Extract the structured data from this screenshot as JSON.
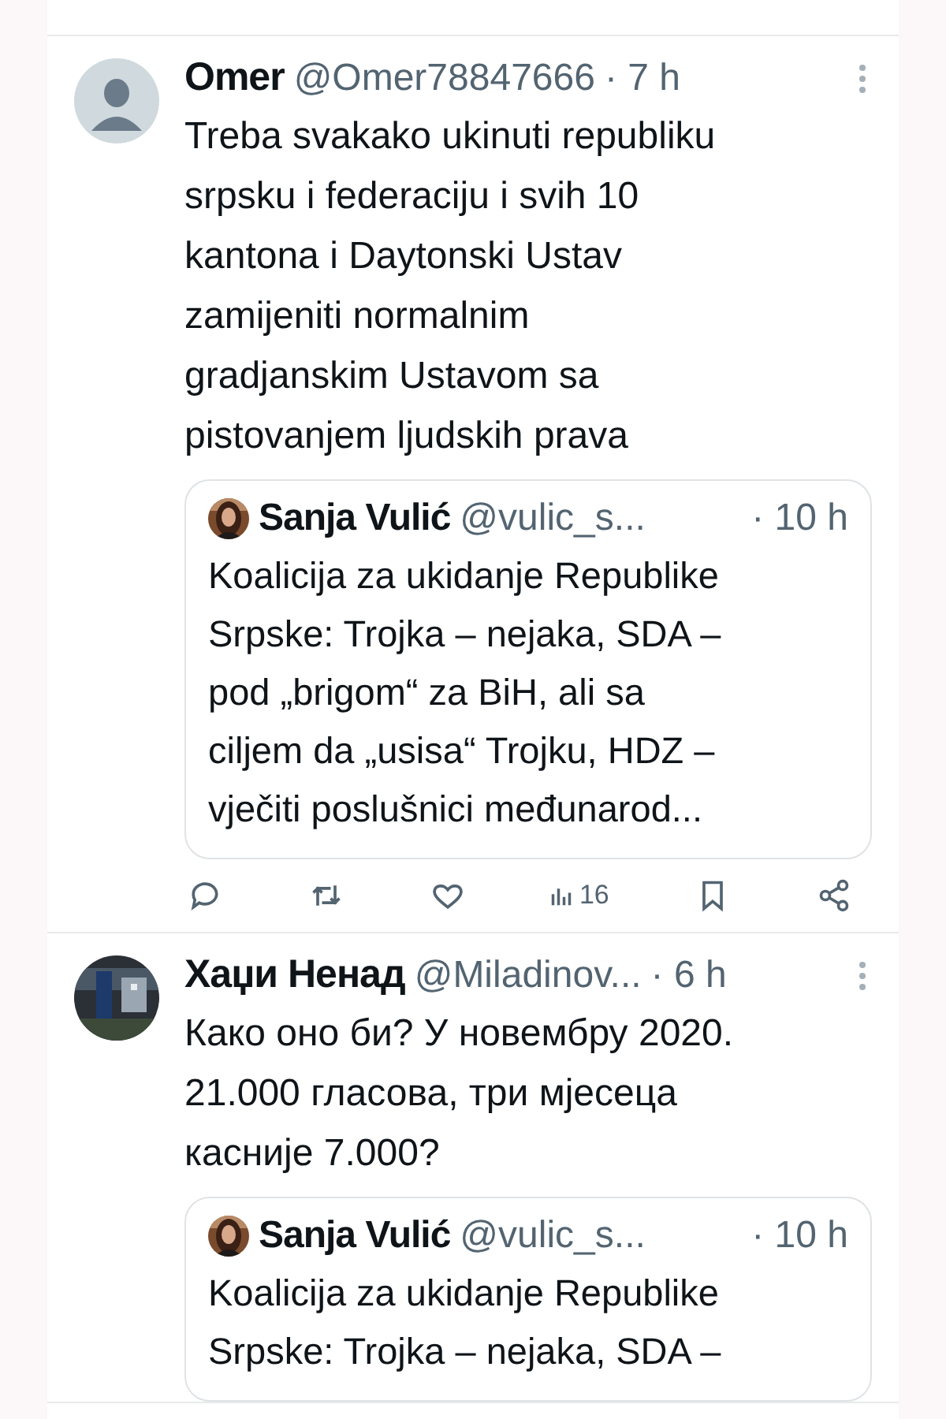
{
  "tweets": [
    {
      "avatar": {
        "kind": "default"
      },
      "author": "Omer",
      "handle": "@Omer78847666",
      "time": "· 7 h",
      "text": "Treba svakako ukinuti republiku\nsrpsku i federaciju i svih 10\nkantona i Daytonski Ustav\nzamijeniti normalnim\ngradjanskim Ustavom sa\npistovanjem ljudskih prava",
      "quote": {
        "author": "Sanja Vulić",
        "handle": "@vulic_s...",
        "time": "· 10 h",
        "text": "Koalicija za ukidanje Republike\nSrpske: Trojka – nejaka, SDA –\npod „brigom“ za BiH, ali sa\nciljem da „usisa“ Trojku, HDZ –\nvječiti poslušnici međunarod..."
      },
      "actions": [
        {
          "kind": "reply"
        },
        {
          "kind": "repost"
        },
        {
          "kind": "like"
        },
        {
          "kind": "views",
          "count": "16"
        },
        {
          "kind": "bookmark"
        },
        {
          "kind": "share"
        }
      ]
    },
    {
      "author": "Хаџи Ненад",
      "handle": "@Miladinov...",
      "time": "· 6 h",
      "text": "Како оно би? У новембру 2020.\n21.000 гласова, три мјесеца\nкасније 7.000?",
      "quote": {
        "author": "Sanja Vulić",
        "handle": "@vulic_s...",
        "time": "· 10 h",
        "text": "Koalicija za ukidanje Republike\nSrpske: Trojka – nejaka, SDA –"
      }
    }
  ]
}
